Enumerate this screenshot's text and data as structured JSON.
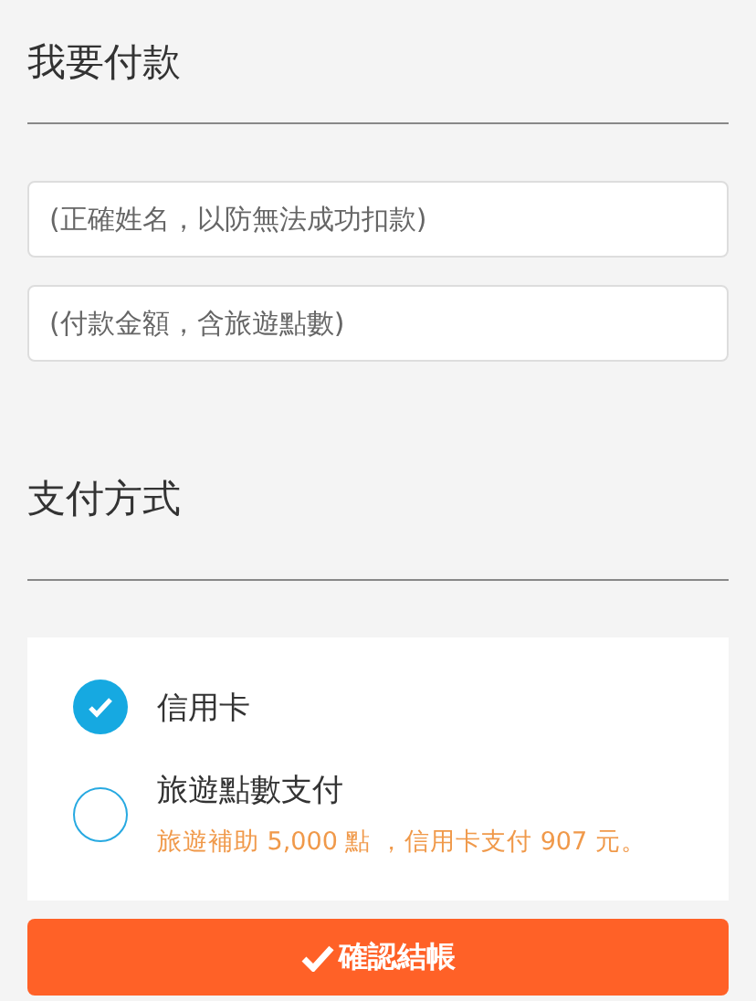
{
  "payment_section": {
    "title": "我要付款"
  },
  "fields": [
    {
      "placeholder": "(正確姓名，以防無法成功扣款)"
    },
    {
      "placeholder": "(付款金額，含旅遊點數)"
    }
  ],
  "method_section": {
    "title": "支付方式"
  },
  "methods": [
    {
      "label": "信用卡",
      "selected": true
    },
    {
      "label": "旅遊點數支付",
      "selected": false,
      "note": "旅遊補助 5,000 點 ，信用卡支付 907 元。"
    }
  ],
  "submit_button": {
    "label": "確認結帳"
  }
}
